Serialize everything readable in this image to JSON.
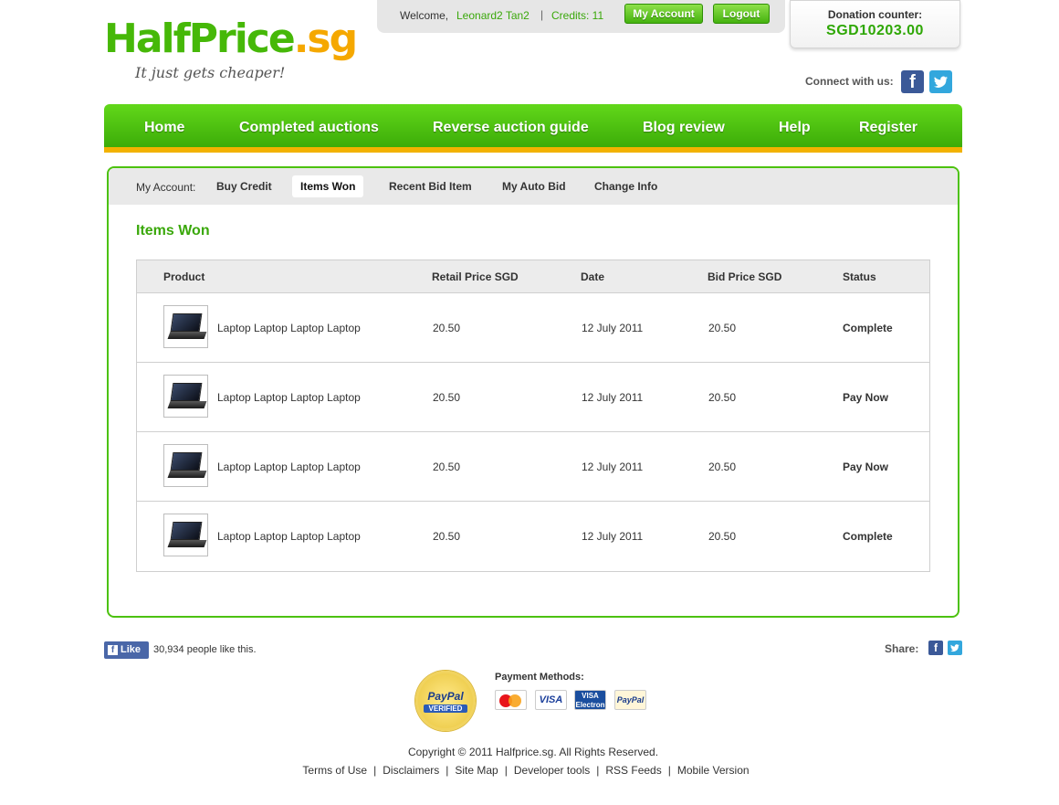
{
  "header": {
    "logo": {
      "part1": "Half",
      "part2": "Price",
      "dot": ".",
      "part3": "sg",
      "tagline": "It just gets cheaper!"
    },
    "user": {
      "welcome": "Welcome,",
      "name": "Leonard2 Tan2",
      "separator": "|",
      "credits": "Credits: 11"
    },
    "buttons": {
      "my_account": "My Account",
      "logout": "Logout"
    },
    "donation": {
      "label": "Donation counter:",
      "value": "SGD10203.00"
    },
    "connect_label": "Connect with us:",
    "social": {
      "facebook_glyph": "f",
      "twitter_glyph": "t"
    }
  },
  "nav": {
    "items": [
      {
        "label": "Home"
      },
      {
        "label": "Completed auctions"
      },
      {
        "label": "Reverse auction guide"
      },
      {
        "label": "Blog review"
      },
      {
        "label": "Help"
      },
      {
        "label": "Register"
      }
    ]
  },
  "account": {
    "label": "My Account:",
    "tabs": [
      {
        "label": "Buy Credit",
        "active": false
      },
      {
        "label": "Items Won",
        "active": true
      },
      {
        "label": "Recent Bid Item",
        "active": false
      },
      {
        "label": "My Auto Bid",
        "active": false
      },
      {
        "label": "Change Info",
        "active": false
      }
    ],
    "section_title": "Items Won"
  },
  "table": {
    "headers": {
      "product": "Product",
      "retail": "Retail Price SGD",
      "date": "Date",
      "bid": "Bid Price SGD",
      "status": "Status"
    },
    "rows": [
      {
        "product": "Laptop Laptop Laptop Laptop",
        "retail": "20.50",
        "date": "12 July 2011",
        "bid": "20.50",
        "status": "Complete",
        "status_type": "complete"
      },
      {
        "product": "Laptop Laptop Laptop Laptop",
        "retail": "20.50",
        "date": "12 July 2011",
        "bid": "20.50",
        "status": "Pay Now",
        "status_type": "pay"
      },
      {
        "product": "Laptop Laptop Laptop Laptop",
        "retail": "20.50",
        "date": "12 July 2011",
        "bid": "20.50",
        "status": "Pay Now",
        "status_type": "pay"
      },
      {
        "product": "Laptop Laptop Laptop Laptop",
        "retail": "20.50",
        "date": "12 July 2011",
        "bid": "20.50",
        "status": "Complete",
        "status_type": "complete"
      }
    ]
  },
  "footer": {
    "like_button": "Like",
    "like_text": "30,934 people like this.",
    "share_label": "Share:",
    "paypal_seal": {
      "brand": "PayPal",
      "verified": "VERIFIED"
    },
    "payment_label": "Payment Methods:",
    "cards": {
      "visa": "VISA",
      "visa_electron_1": "VISA",
      "visa_electron_2": "Electron",
      "paypal": "PayPal"
    },
    "copyright": "Copyright © 2011 Halfprice.sg. All Rights Reserved.",
    "links": [
      "Terms of Use",
      "Disclaimers",
      "Site Map",
      "Developer tools",
      "RSS Feeds",
      "Mobile Version"
    ],
    "link_separator": "|"
  },
  "colors": {
    "brand_green": "#46b808",
    "accent_orange": "#f2b200",
    "pay_now": "#26b300"
  }
}
